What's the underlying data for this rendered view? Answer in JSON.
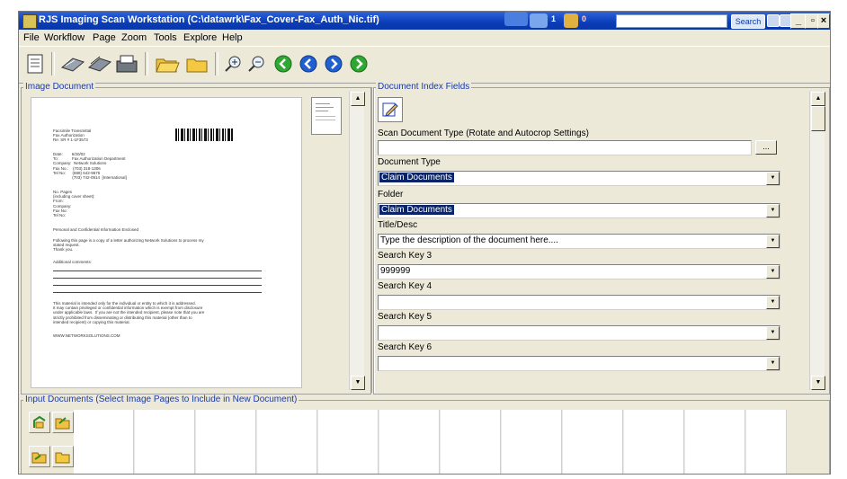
{
  "window": {
    "title": "RJS Imaging Scan Workstation (C:\\datawrk\\Fax_Cover-Fax_Auth_Nic.tif)",
    "counter_a": "1",
    "counter_b": "0",
    "search_label": "Search",
    "minimize": "_",
    "maximize": "▫",
    "close": "×"
  },
  "menu": [
    "File",
    "Workflow",
    "Page",
    "Zoom",
    "Tools",
    "Explore",
    "Help"
  ],
  "image_document": {
    "label": "Image Document",
    "page": {
      "header_left": "Facsimile Transmittal\nFax Authorization\nRe: SR # 1-1F3573",
      "details": "Date:        6/20/02\nTo:            Fax Authorization Department\nCompany:  Network Solutions\nFax No.:    (703) 318-1306\nTel No:      (888) 642-9675\n                 (703) 742-0914  [International]",
      "recipient": "No. Pages\n(including cover sheet):\nFrom:\nCompany:\nFax No:\nTel No:",
      "confidential": "Personal and Confidential Information Enclosed",
      "body": "Following this page is a copy of a letter authorizing Network Solutions to process my\nstated request.\nThank you.",
      "comments": "Additional comments:",
      "notice": "This material is intended only for the individual or entity to which it is addressed.\nIt may contain privileged or confidential information which is exempt from disclosure\nunder applicable laws.  If you are not the intended recipient, please note that you are\nstrictly prohibited from disseminating or distributing this material (other than to\nintended recipient) or copying this material.",
      "website": "WWW.NETWORKSOLUTIONS.COM"
    }
  },
  "index_fields": {
    "label": "Document Index Fields",
    "scan_type_label": "Scan Document Type (Rotate and Autocrop Settings)",
    "scan_type_value": "",
    "browse_label": "...",
    "document_type_label": "Document Type",
    "document_type_value": "Claim Documents",
    "folder_label": "Folder",
    "folder_value": "Claim Documents",
    "title_label": "Title/Desc",
    "title_value": "Type the description of the document here....",
    "key3_label": "Search Key 3",
    "key3_value": "999999",
    "key4_label": "Search Key 4",
    "key4_value": "",
    "key5_label": "Search Key 5",
    "key5_value": "",
    "key6_label": "Search Key 6",
    "key6_value": ""
  },
  "input_documents": {
    "label": "Input Documents  (Select Image Pages to Include in New Document)"
  },
  "colors": {
    "titlebar": "#0a3db8",
    "selection": "#0a246a",
    "group_label": "#1a3aa8",
    "window_bg": "#ece9d8"
  },
  "icons": [
    "document-icon",
    "scan-icon",
    "scan-batch-icon",
    "scanner-icon",
    "open-folder-icon",
    "folder-icon",
    "zoom-in-icon",
    "zoom-out-icon",
    "first-page-icon",
    "previous-page-icon",
    "next-page-icon",
    "last-page-icon"
  ]
}
